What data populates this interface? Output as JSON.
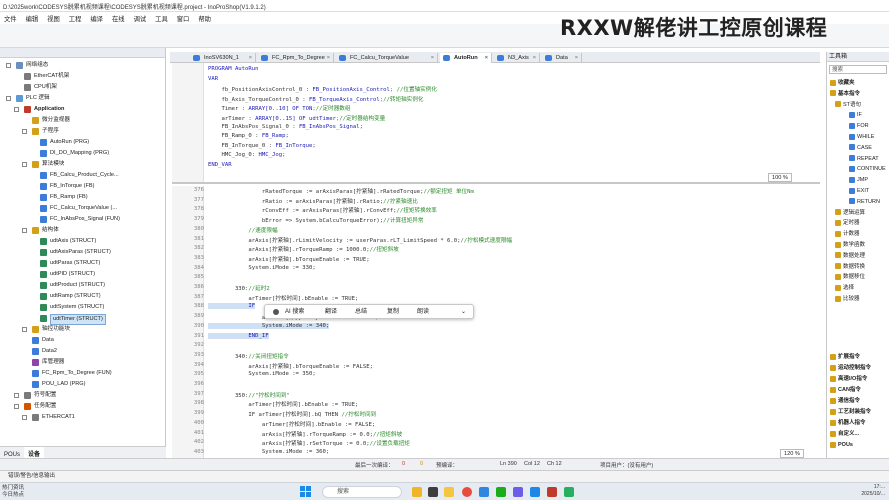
{
  "window": {
    "title": "D:\\2025work\\CODESYS脱累机视频课程\\CODESYS脱累机视频课程.project - InoProShop(V1.9.1.2)"
  },
  "brand": {
    "text": "RXXW解佬讲工控原创课程"
  },
  "menu": [
    "文件",
    "编辑",
    "视图",
    "工程",
    "编译",
    "在线",
    "调试",
    "工具",
    "窗口",
    "帮助"
  ],
  "tree": [
    {
      "indent": 2,
      "exp": "-",
      "label": "网络组态",
      "color": "#6a8fbf"
    },
    {
      "indent": 3,
      "exp": "",
      "label": "EtherCAT机架",
      "color": "#7a7a7a"
    },
    {
      "indent": 3,
      "exp": "",
      "label": "CPU机架",
      "color": "#7a7a7a"
    },
    {
      "indent": 2,
      "exp": "-",
      "label": "PLC 逻辑",
      "color": "#5b9bd5"
    },
    {
      "indent": 3,
      "exp": "-",
      "label": "Application",
      "color": "#c0392b",
      "bold": true
    },
    {
      "indent": 4,
      "exp": "",
      "label": "微分监视器",
      "color": "#d4a017"
    },
    {
      "indent": 4,
      "exp": "-",
      "label": "子程序",
      "color": "#d4a017"
    },
    {
      "indent": 5,
      "exp": "",
      "label": "AutoRun (PRG)",
      "color": "#3b7dd8"
    },
    {
      "indent": 5,
      "exp": "",
      "label": "DI_DO_Mapping (PRG)",
      "color": "#3b7dd8"
    },
    {
      "indent": 4,
      "exp": "-",
      "label": "算法模块",
      "color": "#d4a017"
    },
    {
      "indent": 5,
      "exp": "",
      "label": "FB_Calcu_Product_Cycle...",
      "color": "#3b7dd8"
    },
    {
      "indent": 5,
      "exp": "",
      "label": "FB_InTorque (FB)",
      "color": "#3b7dd8"
    },
    {
      "indent": 5,
      "exp": "",
      "label": "FB_Ramp (FB)",
      "color": "#3b7dd8"
    },
    {
      "indent": 5,
      "exp": "",
      "label": "FC_Calcu_TorqueValue (...",
      "color": "#3b7dd8"
    },
    {
      "indent": 5,
      "exp": "",
      "label": "FC_InAbsPos_Signal (FUN)",
      "color": "#3b7dd8"
    },
    {
      "indent": 4,
      "exp": "-",
      "label": "结构体",
      "color": "#d4a017"
    },
    {
      "indent": 5,
      "exp": "",
      "label": "udtAxis (STRUCT)",
      "color": "#2e8b57"
    },
    {
      "indent": 5,
      "exp": "",
      "label": "udtAxisParas (STRUCT)",
      "color": "#2e8b57"
    },
    {
      "indent": 5,
      "exp": "",
      "label": "udtParas (STRUCT)",
      "color": "#2e8b57"
    },
    {
      "indent": 5,
      "exp": "",
      "label": "udtPID (STRUCT)",
      "color": "#2e8b57"
    },
    {
      "indent": 5,
      "exp": "",
      "label": "udtProduct (STRUCT)",
      "color": "#2e8b57"
    },
    {
      "indent": 5,
      "exp": "",
      "label": "udtRamp (STRUCT)",
      "color": "#2e8b57"
    },
    {
      "indent": 5,
      "exp": "",
      "label": "udtSystem (STRUCT)",
      "color": "#2e8b57"
    },
    {
      "indent": 5,
      "exp": "",
      "label": "udtTimer (STRUCT)",
      "color": "#2e8b57",
      "selected": true
    },
    {
      "indent": 4,
      "exp": "+",
      "label": "轴控功能块",
      "color": "#d4a017"
    },
    {
      "indent": 4,
      "exp": "",
      "label": "Data",
      "color": "#3b7dd8"
    },
    {
      "indent": 4,
      "exp": "",
      "label": "Data2",
      "color": "#3b7dd8"
    },
    {
      "indent": 4,
      "exp": "",
      "label": "库管理器",
      "color": "#8e44ad"
    },
    {
      "indent": 4,
      "exp": "",
      "label": "FC_Rpm_To_Degree (FUN)",
      "color": "#3b7dd8"
    },
    {
      "indent": 4,
      "exp": "",
      "label": "POU_LAD (PRG)",
      "color": "#3b7dd8"
    },
    {
      "indent": 3,
      "exp": "+",
      "label": "符号配置",
      "color": "#7a7a7a"
    },
    {
      "indent": 3,
      "exp": "-",
      "label": "任务配置",
      "color": "#d35400"
    },
    {
      "indent": 4,
      "exp": "-",
      "label": "ETHERCAT1",
      "color": "#7a7a7a"
    }
  ],
  "leftTabs": [
    "POUs",
    "设备"
  ],
  "tabs": [
    {
      "label": "InoSV630N_1",
      "active": false
    },
    {
      "label": "FC_Rpm_To_Degree",
      "active": false
    },
    {
      "label": "FC_Calcu_TorqueValue",
      "active": false
    },
    {
      "label": "AutoRun",
      "active": true
    },
    {
      "label": "N3_Axis",
      "active": false
    },
    {
      "label": "Data",
      "active": false
    }
  ],
  "decl": [
    [
      {
        "t": "PROGRAM AutoRun",
        "c": "kw"
      }
    ],
    [
      {
        "t": "VAR",
        "c": "kw"
      }
    ],
    [
      {
        "t": "    fb_PositionAxisControl_0 : ",
        "c": ""
      },
      {
        "t": "FB_PositionAxis_Control",
        "c": "kw"
      },
      {
        "t": "; //位置轴实例化",
        "c": "cm"
      }
    ],
    [
      {
        "t": "    fb_Axis_TorqueControl_0 : ",
        "c": ""
      },
      {
        "t": "FB_TorqueAxis_Control",
        "c": "kw"
      },
      {
        "t": ";//转矩轴实例化",
        "c": "cm"
      }
    ],
    [
      {
        "t": "    Timer : ",
        "c": ""
      },
      {
        "t": "ARRAY[0..10] OF TON",
        "c": "kw"
      },
      {
        "t": ";//定时器数组",
        "c": "cm"
      }
    ],
    [
      {
        "t": "    arTimer : ",
        "c": ""
      },
      {
        "t": "ARRAY[0..15] OF udtTimer",
        "c": "kw"
      },
      {
        "t": ";//定时器结构变量",
        "c": "cm"
      }
    ],
    [
      {
        "t": "    FB_InAbsPos_Signal_0 : ",
        "c": ""
      },
      {
        "t": "FB_InAbsPos_Signal",
        "c": "kw"
      },
      {
        "t": ";",
        "c": ""
      }
    ],
    [
      {
        "t": "    FB_Ramp_0 : ",
        "c": ""
      },
      {
        "t": "FB_Ramp",
        "c": "kw"
      },
      {
        "t": ";",
        "c": ""
      }
    ],
    [
      {
        "t": "    FB_InTorque_0 : ",
        "c": ""
      },
      {
        "t": "FB_InTorque",
        "c": "kw"
      },
      {
        "t": ";",
        "c": ""
      }
    ],
    [
      {
        "t": "    HMC_Jog_0: ",
        "c": ""
      },
      {
        "t": "HMC_Jog",
        "c": "kw"
      },
      {
        "t": ";",
        "c": ""
      }
    ],
    [
      {
        "t": "END_VAR",
        "c": "kw"
      }
    ]
  ],
  "declZoom": "100 %",
  "code": [
    {
      "n": "376",
      "parts": [
        {
          "t": "                rRatedTorque := arAxisParas[拧紧轴].rRatedTorque;",
          "c": ""
        },
        {
          "t": "//额定扭矩 单位Nm",
          "c": "cm"
        }
      ]
    },
    {
      "n": "377",
      "parts": [
        {
          "t": "                rRatio := arAxisParas[拧紧轴].rRatio;",
          "c": ""
        },
        {
          "t": "//拧紧轴速比",
          "c": "cm"
        }
      ]
    },
    {
      "n": "378",
      "parts": [
        {
          "t": "                rConvEff := arAxisParas[拧紧轴].rConvEff;",
          "c": ""
        },
        {
          "t": "//扭矩转换效率",
          "c": "cm"
        }
      ]
    },
    {
      "n": "379",
      "parts": [
        {
          "t": "                bError => System.bCalcuTorqueError);",
          "c": ""
        },
        {
          "t": "//计算扭矩异常",
          "c": "cm"
        }
      ]
    },
    {
      "n": "380",
      "parts": [
        {
          "t": "            ",
          "c": ""
        },
        {
          "t": "//速度限幅",
          "c": "cm"
        }
      ]
    },
    {
      "n": "381",
      "parts": [
        {
          "t": "            arAxis[拧紧轴].rLimitVelocity := userParas.rLT_LimitSpeed * 6.0;",
          "c": ""
        },
        {
          "t": "//拧松模式速度限幅",
          "c": "cm"
        }
      ]
    },
    {
      "n": "382",
      "parts": [
        {
          "t": "            arAxis[拧紧轴].rTorqueRamp := 1000.0;",
          "c": ""
        },
        {
          "t": "//扭矩斜坡",
          "c": "cm"
        }
      ]
    },
    {
      "n": "383",
      "parts": [
        {
          "t": "            arAxis[拧紧轴].bTorqueEnable := TRUE;",
          "c": ""
        }
      ]
    },
    {
      "n": "384",
      "parts": [
        {
          "t": "            System.iMode := 330;",
          "c": ""
        }
      ]
    },
    {
      "n": "385",
      "parts": [
        {
          "t": "",
          "c": ""
        }
      ]
    },
    {
      "n": "386",
      "parts": [
        {
          "t": "        330:",
          "c": ""
        },
        {
          "t": "//延时2",
          "c": "cm"
        }
      ]
    },
    {
      "n": "387",
      "parts": [
        {
          "t": "            arTimer[拧松时间].bEnable := TRUE;",
          "c": ""
        }
      ]
    },
    {
      "n": "388",
      "parts": [
        {
          "t": "            IF",
          "c": "kw"
        }
      ]
    },
    {
      "n": "389",
      "parts": [
        {
          "t": "                arTimer[拧][50ms].bEnable := FALSE;",
          "c": ""
        }
      ]
    },
    {
      "n": "390",
      "parts": [
        {
          "t": "                System.iMode := 340;",
          "c": ""
        }
      ]
    },
    {
      "n": "391",
      "parts": [
        {
          "t": "            END_IF",
          "c": "kw"
        }
      ]
    },
    {
      "n": "392",
      "parts": [
        {
          "t": "",
          "c": ""
        }
      ]
    },
    {
      "n": "393",
      "parts": [
        {
          "t": "        340:",
          "c": ""
        },
        {
          "t": "//关闭扭矩指令",
          "c": "cm"
        }
      ]
    },
    {
      "n": "394",
      "parts": [
        {
          "t": "            arAxis[拧紧轴].bTorqueEnable := FALSE;",
          "c": ""
        }
      ]
    },
    {
      "n": "395",
      "parts": [
        {
          "t": "            System.iMode := 350;",
          "c": ""
        }
      ]
    },
    {
      "n": "396",
      "parts": [
        {
          "t": "",
          "c": ""
        }
      ]
    },
    {
      "n": "397",
      "parts": [
        {
          "t": "        350:",
          "c": ""
        },
        {
          "t": "//\"拧松时间到\"",
          "c": "cm"
        }
      ]
    },
    {
      "n": "398",
      "parts": [
        {
          "t": "            arTimer[拧松时间].bEnable := TRUE;",
          "c": ""
        }
      ]
    },
    {
      "n": "399",
      "parts": [
        {
          "t": "            IF arTimer[拧松时间].bQ THEN ",
          "c": ""
        },
        {
          "t": "//拧松时间到",
          "c": "cm"
        }
      ]
    },
    {
      "n": "400",
      "parts": [
        {
          "t": "                arTimer[拧松时间].bEnable := FALSE;",
          "c": ""
        }
      ]
    },
    {
      "n": "401",
      "parts": [
        {
          "t": "                arAxis[拧紧轴].rTorqueRamp := 0.0;",
          "c": ""
        },
        {
          "t": "//扭矩斜坡",
          "c": "cm"
        }
      ]
    },
    {
      "n": "402",
      "parts": [
        {
          "t": "                arAxis[拧紧轴].rSetTorque := 0.0;",
          "c": ""
        },
        {
          "t": "//设置负载扭矩",
          "c": "cm"
        }
      ]
    },
    {
      "n": "403",
      "parts": [
        {
          "t": "                System.iMode := 360;",
          "c": ""
        }
      ]
    }
  ],
  "codeZoom": "120 %",
  "context": [
    "AI 搜索",
    "翻译",
    "总结",
    "复制",
    "朗读"
  ],
  "right": {
    "title": "工具箱",
    "search": "搜索",
    "groups": [
      {
        "label": "收藏夹",
        "exp": "+"
      },
      {
        "label": "基本指令",
        "exp": "-"
      },
      {
        "label": "ST语句",
        "exp": "-",
        "sub": true
      },
      {
        "label": "IF",
        "exp": "",
        "item": true
      },
      {
        "label": "FOR",
        "exp": "",
        "item": true
      },
      {
        "label": "WHILE",
        "exp": "",
        "item": true
      },
      {
        "label": "CASE",
        "exp": "",
        "item": true
      },
      {
        "label": "REPEAT",
        "exp": "",
        "item": true
      },
      {
        "label": "CONTINUE",
        "exp": "",
        "item": true
      },
      {
        "label": "JMP",
        "exp": "",
        "item": true
      },
      {
        "label": "EXIT",
        "exp": "",
        "item": true
      },
      {
        "label": "RETURN",
        "exp": "",
        "item": true
      },
      {
        "label": "逻辑运算",
        "exp": "+",
        "sub": true
      },
      {
        "label": "定时器",
        "exp": "+",
        "sub": true
      },
      {
        "label": "计数器",
        "exp": "+",
        "sub": true
      },
      {
        "label": "数学函数",
        "exp": "+",
        "sub": true
      },
      {
        "label": "数据处理",
        "exp": "+",
        "sub": true
      },
      {
        "label": "数据转换",
        "exp": "+",
        "sub": true
      },
      {
        "label": "数据移位",
        "exp": "+",
        "sub": true
      },
      {
        "label": "选择",
        "exp": "+",
        "sub": true
      },
      {
        "label": "比较器",
        "exp": "+",
        "sub": true
      }
    ],
    "groups2": [
      {
        "label": "扩展指令",
        "exp": "+"
      },
      {
        "label": "运动控制指令",
        "exp": "+"
      },
      {
        "label": "高速I/O指令",
        "exp": "+"
      },
      {
        "label": "CAN指令",
        "exp": "+"
      },
      {
        "label": "通信指令",
        "exp": "+"
      },
      {
        "label": "工艺封装指令",
        "exp": "+"
      },
      {
        "label": "机器人指令",
        "exp": "+"
      },
      {
        "label": "自定义...",
        "exp": "+"
      },
      {
        "label": "POUs",
        "exp": "+"
      }
    ]
  },
  "status": {
    "compile": "最后一次编译：",
    "errs": "0",
    "warns": "0",
    "precompile": "预编译：",
    "ln": "Ln 390",
    "col": "Col 12",
    "ch": "Ch 12",
    "user": "项目用户：(没有用户)"
  },
  "errbar": "错误/警告/信息输出",
  "taskbar": {
    "search": "搜索",
    "news1": "热门资讯",
    "news2": "今日热点",
    "time": "17:...",
    "date": "2025/10/..."
  }
}
